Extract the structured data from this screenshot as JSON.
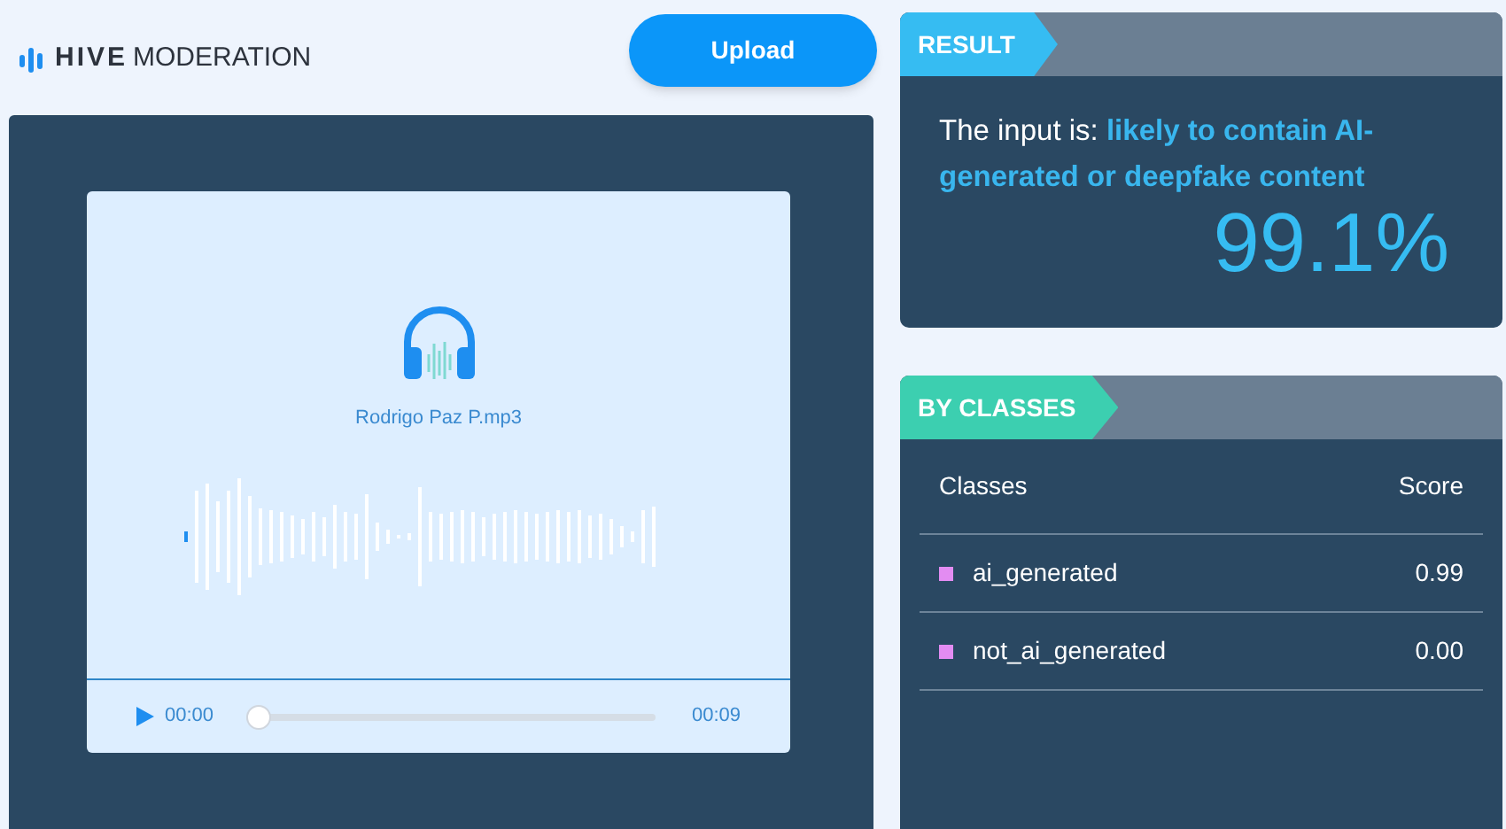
{
  "logo": {
    "brand": "HIVE",
    "product": "MODERATION"
  },
  "upload_button": "Upload",
  "player": {
    "file_name": "Rodrigo Paz P.mp3",
    "current_time": "00:00",
    "duration": "00:09",
    "level": 0
  },
  "result": {
    "tag": "RESULT",
    "prefix": "The input is:",
    "verdict": "likely to contain AI-generated or deepfake content",
    "percent": "99.1%"
  },
  "by_classes": {
    "tag": "BY CLASSES",
    "columns": [
      "Classes",
      "Score"
    ],
    "rows": [
      {
        "name": "ai_generated",
        "score": "0.99",
        "color": "#e38cf2"
      },
      {
        "name": "not_ai_generated",
        "score": "0.00",
        "color": "#e38cf2"
      }
    ]
  }
}
